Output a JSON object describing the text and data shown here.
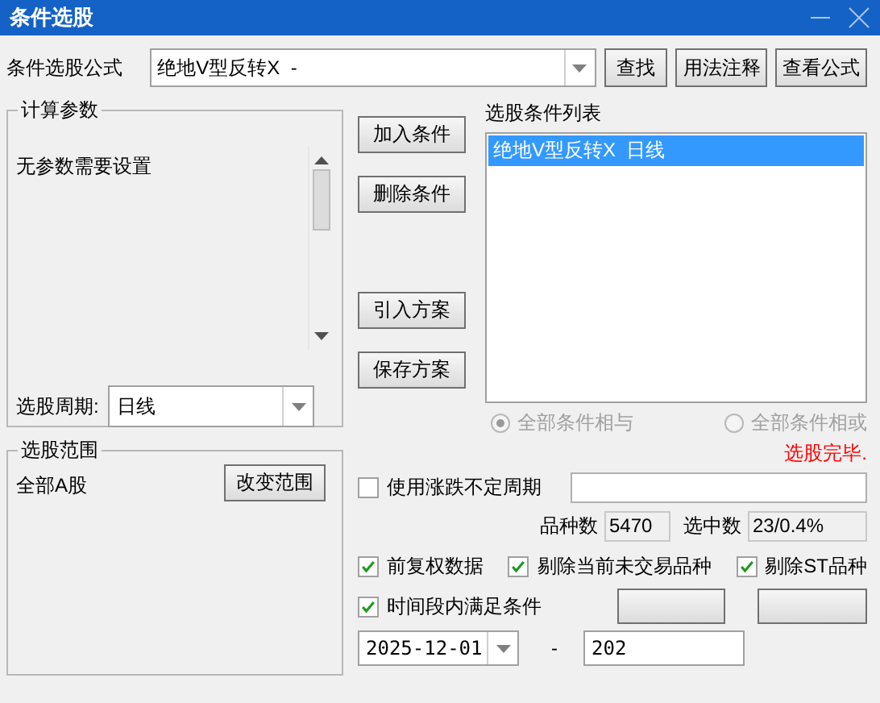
{
  "window": {
    "title": "条件选股"
  },
  "formula": {
    "label": "条件选股公式",
    "value": "绝地V型反转X  -"
  },
  "top_buttons": [
    "查找",
    "用法注释",
    "查看公式"
  ],
  "params": {
    "title": "计算参数",
    "message": "无参数需要设置",
    "period_label": "选股周期:",
    "period_value": "日线"
  },
  "action_buttons": [
    "加入条件",
    "删除条件",
    "引入方案",
    "保存方案"
  ],
  "conditions": {
    "title": "选股条件列表",
    "items": [
      {
        "label": "绝地V型反转X  日线",
        "selected": true
      }
    ]
  },
  "logic": {
    "disabled": true,
    "options": [
      {
        "label": "全部条件相与",
        "selected": true
      },
      {
        "label": "全部条件相或",
        "selected": false
      }
    ]
  },
  "scope": {
    "title": "选股范围",
    "value": "全部A股",
    "button": "改变范围"
  },
  "status": "选股完毕.",
  "variable_period": {
    "label": "使用涨跌不定周期",
    "checked": false
  },
  "counts": [
    {
      "label": "品种数",
      "value": "5470"
    },
    {
      "label": "选中数",
      "value": "23/0.4%"
    }
  ],
  "options": [
    {
      "label": "前复权数据",
      "checked": true
    },
    {
      "label": "剔除当前未交易品种",
      "checked": true
    },
    {
      "label": "剔除ST品种",
      "checked": true
    }
  ],
  "time_range": {
    "label": "时间段内满足条件",
    "checked": true,
    "start": "2025-12-01",
    "separator": "-",
    "end": "202"
  }
}
